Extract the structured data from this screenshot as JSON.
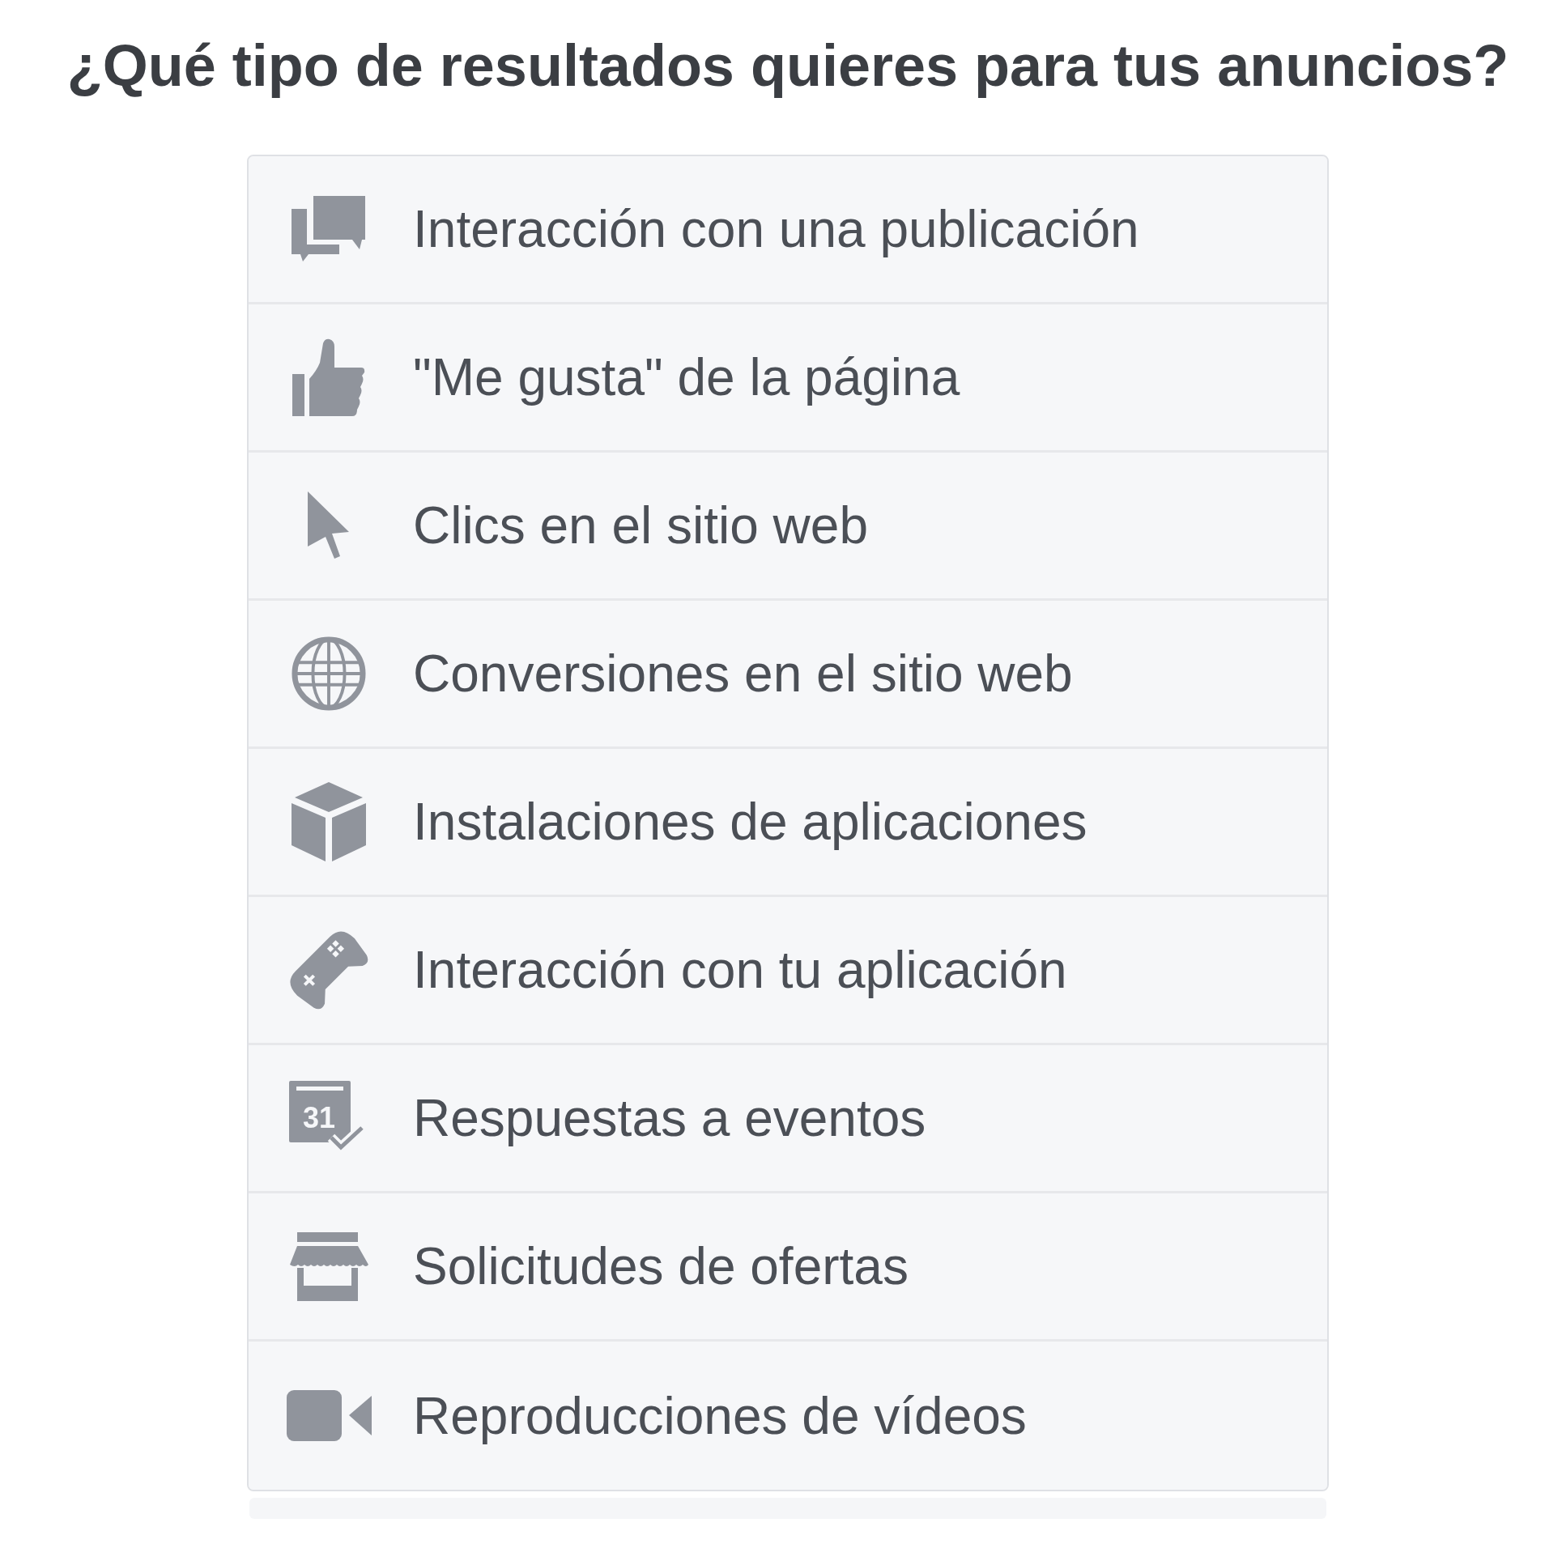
{
  "title": "¿Qué tipo de resultados quieres para tus anuncios?",
  "options": [
    {
      "kind": "engagement",
      "label": "Interacción con una publicación",
      "selected": false
    },
    {
      "kind": "likes",
      "label": "\"Me gusta\" de la página",
      "selected": false
    },
    {
      "kind": "clicks",
      "label": "Clics en el sitio web",
      "selected": false
    },
    {
      "kind": "conversions",
      "label": "Conversiones en el sitio web",
      "selected": false
    },
    {
      "kind": "installs",
      "label": "Instalaciones de aplicaciones",
      "selected": false
    },
    {
      "kind": "app",
      "label": "Interacción con tu aplicación",
      "selected": false
    },
    {
      "kind": "events",
      "label": "Respuestas a eventos",
      "icon_label": "31",
      "selected": false
    },
    {
      "kind": "offers",
      "label": "Solicitudes de ofertas",
      "selected": false
    },
    {
      "kind": "video",
      "label": "Reproducciones de vídeos",
      "selected": false
    }
  ]
}
